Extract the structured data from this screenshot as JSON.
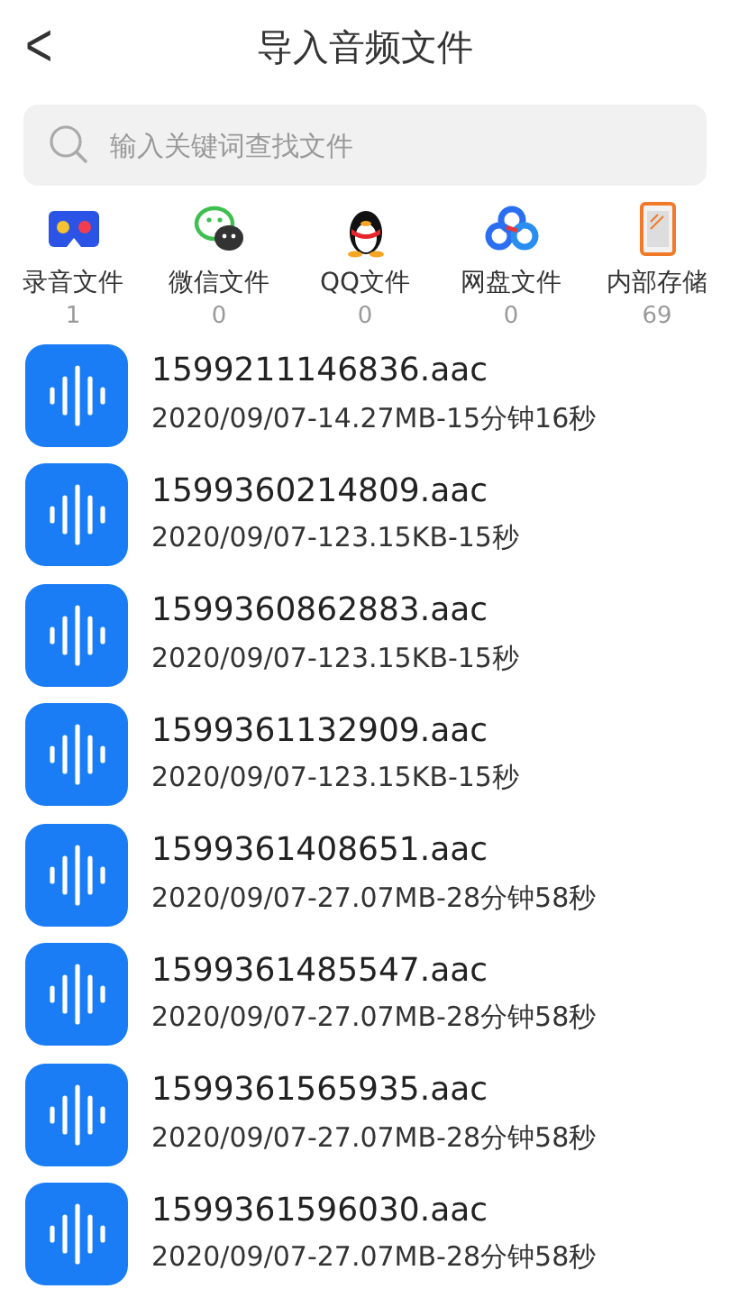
{
  "header": {
    "back": "<",
    "title": "导入音频文件"
  },
  "search": {
    "placeholder": "输入关键词查找文件"
  },
  "sources": [
    {
      "kind": "recorder",
      "label": "录音文件",
      "count": "1"
    },
    {
      "kind": "wechat",
      "label": "微信文件",
      "count": "0"
    },
    {
      "kind": "qq",
      "label": "QQ文件",
      "count": "0"
    },
    {
      "kind": "cloud",
      "label": "网盘文件",
      "count": "0"
    },
    {
      "kind": "phone",
      "label": "内部存储",
      "count": "69"
    }
  ],
  "files": [
    {
      "name": "1599211146836.aac",
      "details": "2020/09/07-14.27MB-15分钟16秒"
    },
    {
      "name": "1599360214809.aac",
      "details": "2020/09/07-123.15KB-15秒"
    },
    {
      "name": "1599360862883.aac",
      "details": "2020/09/07-123.15KB-15秒"
    },
    {
      "name": "1599361132909.aac",
      "details": "2020/09/07-123.15KB-15秒"
    },
    {
      "name": "1599361408651.aac",
      "details": "2020/09/07-27.07MB-28分钟58秒"
    },
    {
      "name": "1599361485547.aac",
      "details": "2020/09/07-27.07MB-28分钟58秒"
    },
    {
      "name": "1599361565935.aac",
      "details": "2020/09/07-27.07MB-28分钟58秒"
    },
    {
      "name": "1599361596030.aac",
      "details": "2020/09/07-27.07MB-28分钟58秒"
    }
  ]
}
